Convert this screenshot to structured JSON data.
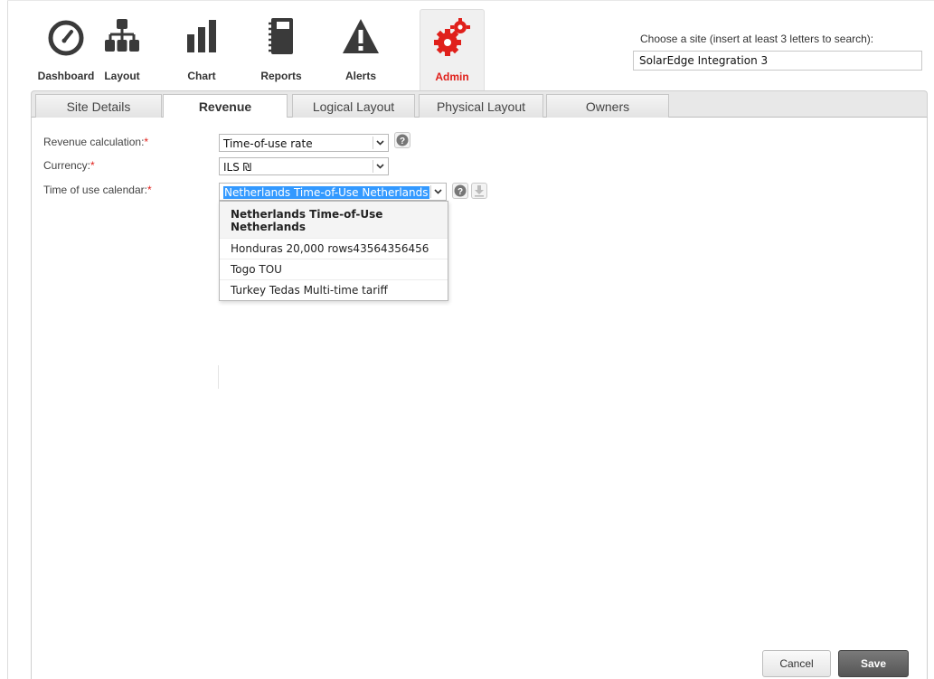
{
  "nav": {
    "items": [
      {
        "label": "Dashboard",
        "icon": "dashboard-icon"
      },
      {
        "label": "Layout",
        "icon": "layout-icon"
      },
      {
        "label": "Chart",
        "icon": "chart-icon"
      },
      {
        "label": "Reports",
        "icon": "reports-icon"
      },
      {
        "label": "Alerts",
        "icon": "alerts-icon"
      },
      {
        "label": "Admin",
        "icon": "admin-gears-icon"
      }
    ],
    "active": "Admin"
  },
  "site_search": {
    "label": "Choose a site (insert at least 3 letters to search):",
    "value": "SolarEdge Integration 3"
  },
  "tabs": [
    "Site Details",
    "Revenue",
    "Logical Layout",
    "Physical Layout",
    "Owners"
  ],
  "active_tab": "Revenue",
  "form": {
    "revenue_calc": {
      "label": "Revenue calculation:",
      "required": "*",
      "value": "Time-of-use rate"
    },
    "currency": {
      "label": "Currency:",
      "required": "*",
      "value": "ILS ₪"
    },
    "tou_calendar": {
      "label": "Time of use calendar:",
      "required": "*",
      "value": "Netherlands Time-of-Use Netherlands"
    }
  },
  "dropdown": {
    "options": [
      "Netherlands Time-of-Use Netherlands",
      "Honduras 20,000 rows43564356456",
      "Togo TOU",
      "Turkey Tedas Multi-time tariff"
    ]
  },
  "buttons": {
    "cancel": "Cancel",
    "save": "Save"
  },
  "colors": {
    "accent": "#e0201b",
    "icon_dark": "#3a3a3a",
    "selection": "#3399ff"
  }
}
